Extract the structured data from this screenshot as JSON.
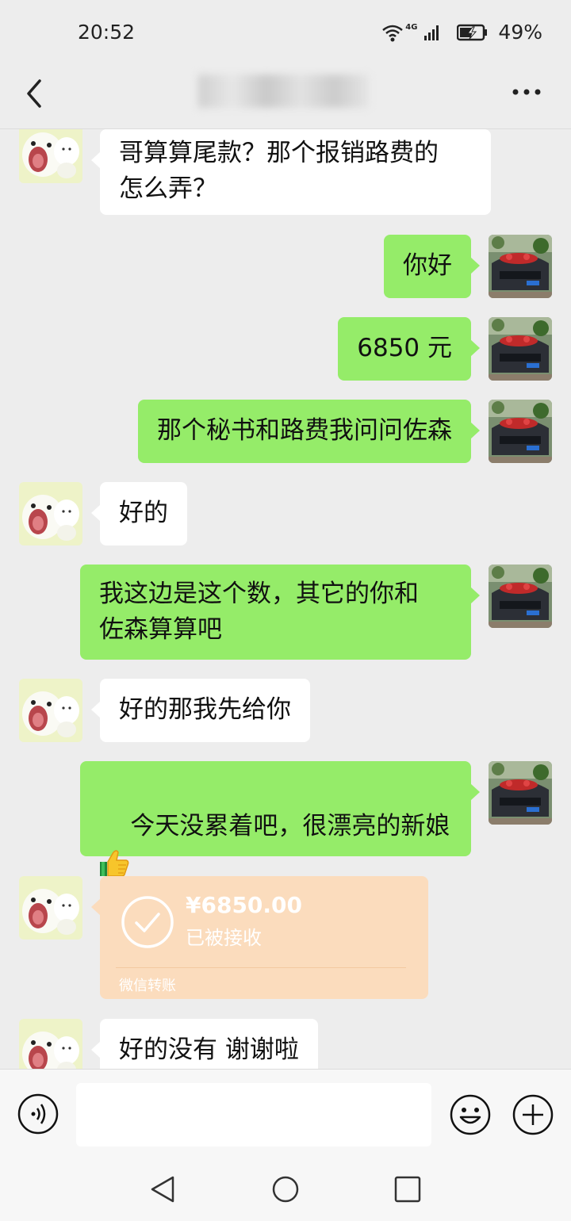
{
  "status_bar": {
    "time": "20:52",
    "network": "4G",
    "battery": "49%"
  },
  "header": {
    "title": "",
    "back_icon": "chevron-left-icon",
    "more_icon": "more-dots-icon"
  },
  "messages": [
    {
      "sender": "other",
      "text": "哥算算尾款？那个报销路费的\n怎么弄？"
    },
    {
      "sender": "me",
      "text": "你好"
    },
    {
      "sender": "me",
      "text": "6850 元"
    },
    {
      "sender": "me",
      "text": "那个秘书和路费我问问佐森"
    },
    {
      "sender": "other",
      "text": "好的"
    },
    {
      "sender": "me",
      "text": "我这边是这个数，其它的你和\n佐森算算吧"
    },
    {
      "sender": "other",
      "text": "好的那我先给你"
    },
    {
      "sender": "me",
      "text": "今天没累着吧，很漂亮的新娘\n"
    },
    {
      "sender": "other",
      "type": "transfer",
      "amount": "¥6850.00",
      "status": "已被接收",
      "label": "微信转账"
    },
    {
      "sender": "other",
      "text": "好的没有 谢谢啦"
    }
  ],
  "input_bar": {
    "placeholder": "",
    "voice_icon": "voice-icon",
    "emoji_icon": "emoji-icon",
    "plus_icon": "plus-icon"
  },
  "colors": {
    "outgoing_bubble": "#95ec69",
    "incoming_bubble": "#ffffff",
    "transfer_card": "#fbdcbd",
    "background": "#ededed"
  }
}
